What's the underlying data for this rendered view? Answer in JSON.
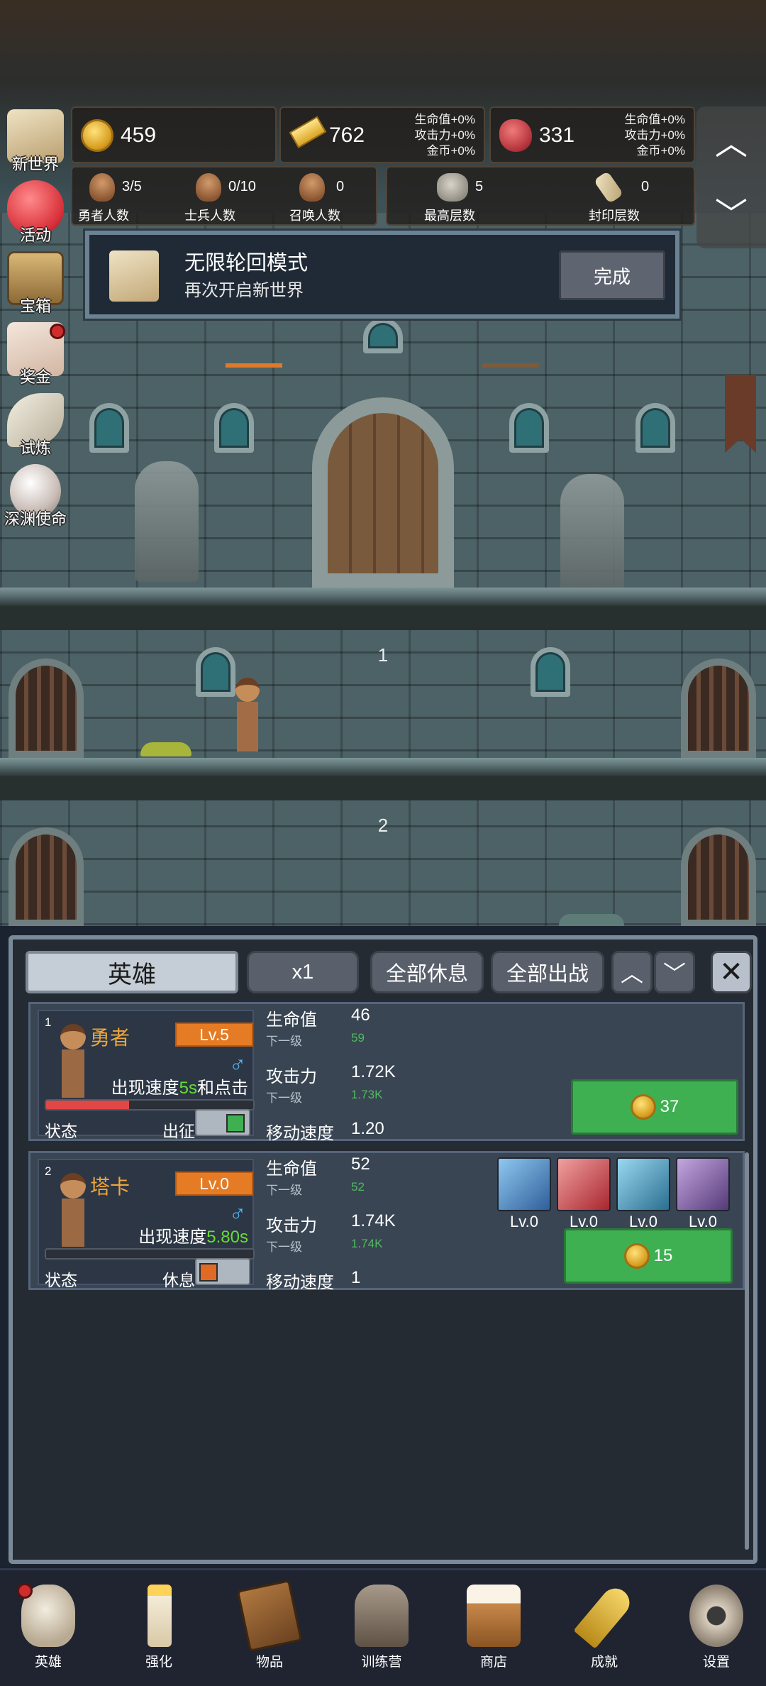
{
  "resources": [
    {
      "icon": "coin-icon",
      "value": "459",
      "bonus": []
    },
    {
      "icon": "gold-bar-icon",
      "value": "762",
      "bonus": [
        "生命值+0%",
        "攻击力+0%",
        "金币+0%"
      ]
    },
    {
      "icon": "ruby-icon",
      "value": "331",
      "bonus": [
        "生命值+0%",
        "攻击力+0%",
        "金币+0%"
      ]
    }
  ],
  "counts": [
    {
      "value": "3/5",
      "label": "勇者人数"
    },
    {
      "value": "0/10",
      "label": "士兵人数"
    },
    {
      "value": "0",
      "label": "召唤人数"
    },
    {
      "value": "5",
      "label": "最高层数"
    },
    {
      "value": "0",
      "label": "封印层数"
    }
  ],
  "nav_arrows": {
    "up": "︿",
    "down": "﹀"
  },
  "side_menu": [
    {
      "label": "新世界",
      "icon": "map-icon",
      "dot": false
    },
    {
      "label": "活动",
      "icon": "heart-icon",
      "dot": false
    },
    {
      "label": "宝箱",
      "icon": "chest-icon",
      "dot": false
    },
    {
      "label": "奖金",
      "icon": "envelope-icon",
      "dot": true
    },
    {
      "label": "试炼",
      "icon": "feather-icon",
      "dot": false
    },
    {
      "label": "深渊使命",
      "icon": "orb-icon",
      "dot": false
    }
  ],
  "mission": {
    "title": "无限轮回模式",
    "subtitle": "再次开启新世界",
    "button": "完成"
  },
  "scene": {
    "floors": [
      "1",
      "2"
    ]
  },
  "panel": {
    "tabs": {
      "main": "英雄",
      "speed": "x1",
      "rest_all": "全部休息",
      "deploy_all": "全部出战",
      "up": "︿",
      "down": "﹀",
      "close": "✕"
    },
    "labels": {
      "hp": "生命值",
      "atk": "攻击力",
      "next": "下一级",
      "move": "移动速度",
      "status": "状态",
      "gender": "♂"
    },
    "heroes": [
      {
        "num": "1",
        "name": "勇者",
        "level": "Lv.5",
        "speed_prefix": "出现速度",
        "speed_value": "5s",
        "speed_suffix": "和点击",
        "hp_fraction": 0.4,
        "state": "出征",
        "toggle": "on",
        "hp": "46",
        "hp_next": "59",
        "atk": "1.72K",
        "atk_next": "1.73K",
        "move": "1.20",
        "cost": "37",
        "skills": []
      },
      {
        "num": "2",
        "name": "塔卡",
        "level": "Lv.0",
        "speed_prefix": "出现速度",
        "speed_value": "5.80s",
        "speed_suffix": "",
        "hp_fraction": 0,
        "state": "休息",
        "toggle": "off",
        "hp": "52",
        "hp_next": "52",
        "atk": "1.74K",
        "atk_next": "1.74K",
        "move": "1",
        "cost": "15",
        "skills": [
          {
            "icon": "shield-cape-icon",
            "level": "Lv.0",
            "color": "#3f7fb8"
          },
          {
            "icon": "axe-icon",
            "level": "Lv.0",
            "color": "#b8343c"
          },
          {
            "icon": "boot-icon",
            "level": "Lv.0",
            "color": "#3a8fb0"
          },
          {
            "icon": "hammer-icon",
            "level": "Lv.0",
            "color": "#6b4a8a"
          }
        ]
      }
    ]
  },
  "bottom_nav": [
    {
      "label": "英雄",
      "icon": "skull-icon",
      "dot": true
    },
    {
      "label": "强化",
      "icon": "candle-icon",
      "dot": false
    },
    {
      "label": "物品",
      "icon": "book-icon",
      "dot": false
    },
    {
      "label": "训练营",
      "icon": "lantern-icon",
      "dot": false
    },
    {
      "label": "商店",
      "icon": "beer-mug-icon",
      "dot": false
    },
    {
      "label": "成就",
      "icon": "key-icon",
      "dot": false
    },
    {
      "label": "设置",
      "icon": "gear-icon",
      "dot": false
    }
  ],
  "colors": {
    "accent_green": "#3fb052",
    "level_orange": "#e57b24",
    "hero_name": "#f0a63a",
    "speed_green": "#66dd36",
    "toggle_on": "#3fb052",
    "toggle_off": "#e06a24"
  }
}
